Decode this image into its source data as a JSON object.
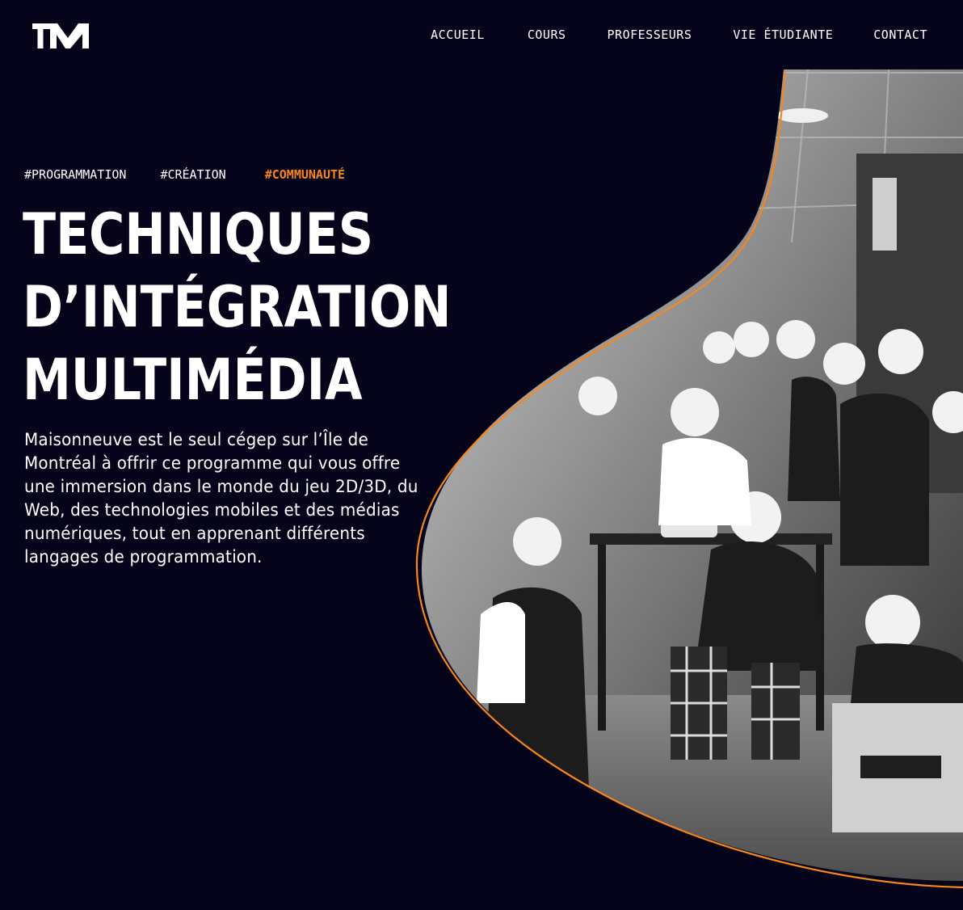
{
  "header": {
    "logo_text": "TIM",
    "nav": [
      "ACCUEIL",
      "COURS",
      "PROFESSEURS",
      "VIE ÉTUDIANTE",
      "CONTACT"
    ]
  },
  "hero": {
    "tags": [
      "#PROGRAMMATION",
      "#CRÉATION",
      "#COMMUNAUTÉ"
    ],
    "title_lines": [
      "TECHNIQUES",
      "D’INTÉGRATION",
      "MULTIMÉDIA"
    ],
    "description": "Maisonneuve est le seul cégep sur l’Île de Montréal à offrir ce programme qui vous offre une immersion dans le monde du jeu 2D/3D, du Web, des technologies mobiles et des médias numériques, tout en apprenant différents langages de programmation."
  },
  "colors": {
    "background": "#05041a",
    "accent": "#f7861d",
    "text": "#ffffff"
  }
}
